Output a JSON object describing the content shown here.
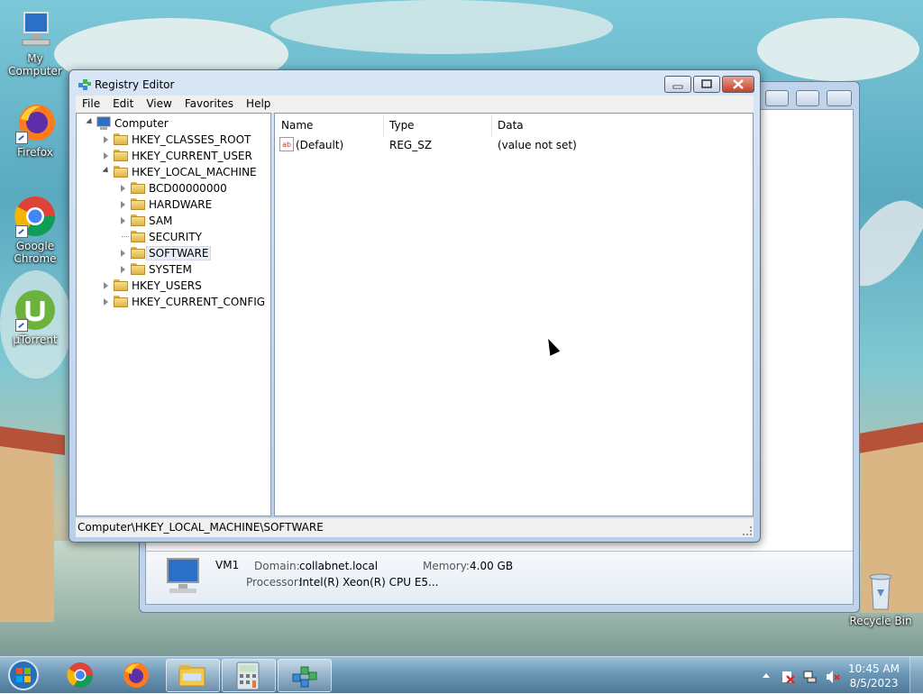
{
  "desktop": {
    "icons": [
      {
        "label": "My Computer",
        "icon": "computer-icon"
      },
      {
        "label": "Firefox",
        "icon": "firefox-icon"
      },
      {
        "label": "Google Chrome",
        "icon": "chrome-icon"
      },
      {
        "label": "µTorrent",
        "icon": "utorrent-icon"
      },
      {
        "label": "Recycle Bin",
        "icon": "recycle-bin-icon"
      }
    ]
  },
  "background_window": {
    "details": {
      "name": "VM1",
      "domain_label": "Domain:",
      "domain": "collabnet.local",
      "memory_label": "Memory:",
      "memory": "4.00 GB",
      "processor_label": "Processor:",
      "processor": "Intel(R) Xeon(R) CPU E5..."
    }
  },
  "regedit": {
    "title": "Registry Editor",
    "menu": [
      "File",
      "Edit",
      "View",
      "Favorites",
      "Help"
    ],
    "tree": [
      {
        "label": "Computer",
        "level": 0,
        "state": "expanded"
      },
      {
        "label": "HKEY_CLASSES_ROOT",
        "level": 1,
        "state": "collapsed"
      },
      {
        "label": "HKEY_CURRENT_USER",
        "level": 1,
        "state": "collapsed"
      },
      {
        "label": "HKEY_LOCAL_MACHINE",
        "level": 1,
        "state": "expanded"
      },
      {
        "label": "BCD00000000",
        "level": 2,
        "state": "collapsed"
      },
      {
        "label": "HARDWARE",
        "level": 2,
        "state": "collapsed"
      },
      {
        "label": "SAM",
        "level": 2,
        "state": "collapsed"
      },
      {
        "label": "SECURITY",
        "level": 2,
        "state": "none"
      },
      {
        "label": "SOFTWARE",
        "level": 2,
        "state": "collapsed",
        "selected": true
      },
      {
        "label": "SYSTEM",
        "level": 2,
        "state": "collapsed"
      },
      {
        "label": "HKEY_USERS",
        "level": 1,
        "state": "collapsed"
      },
      {
        "label": "HKEY_CURRENT_CONFIG",
        "level": 1,
        "state": "collapsed"
      }
    ],
    "columns": [
      "Name",
      "Type",
      "Data"
    ],
    "values": [
      {
        "name": "(Default)",
        "type": "REG_SZ",
        "data": "(value not set)",
        "icon": "string-value-icon"
      }
    ],
    "status": "Computer\\HKEY_LOCAL_MACHINE\\SOFTWARE"
  },
  "taskbar": {
    "items": [
      "start-orb",
      "chrome-icon",
      "firefox-icon",
      "file-explorer-icon",
      "calculator-icon",
      "regedit-icon"
    ],
    "clock": {
      "time": "10:45 AM",
      "date": "8/5/2023"
    }
  }
}
